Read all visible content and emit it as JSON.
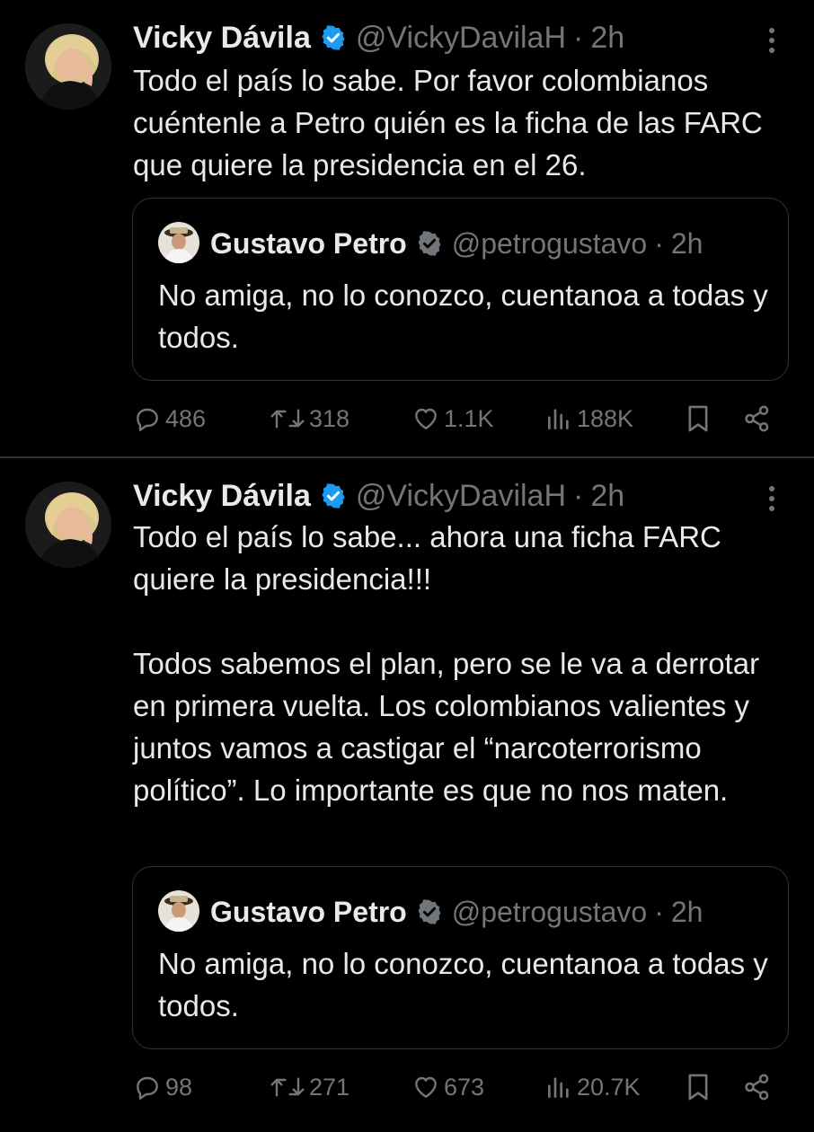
{
  "tweets": [
    {
      "author": {
        "name": "Vicky Dávila",
        "handle": "@VickyDavilaH",
        "time": "2h"
      },
      "text": "Todo el país lo sabe. Por favor colombianos cuéntenle a Petro quién es la ficha de las FARC que quiere la presidencia en el 26.",
      "quote": {
        "author": {
          "name": "Gustavo Petro",
          "handle": "@petrogustavo",
          "time": "2h"
        },
        "text": "No amiga, no lo conozco, cuentanoa a todas y todos."
      },
      "stats": {
        "replies": "486",
        "reposts": "318",
        "likes": "1.1K",
        "views": "188K"
      }
    },
    {
      "author": {
        "name": "Vicky Dávila",
        "handle": "@VickyDavilaH",
        "time": "2h"
      },
      "text": "Todo el país lo sabe... ahora una ficha FARC quiere la presidencia!!!\n\nTodos sabemos el plan, pero se le va a derrotar en primera vuelta. Los colombianos valientes y juntos vamos a castigar el “narcoterrorismo político”. Lo importante es que no nos maten.",
      "quote": {
        "author": {
          "name": "Gustavo Petro",
          "handle": "@petrogustavo",
          "time": "2h"
        },
        "text": "No amiga, no lo conozco, cuentanoa a todas y todos."
      },
      "stats": {
        "replies": "98",
        "reposts": "271",
        "likes": "673",
        "views": "20.7K"
      }
    }
  ],
  "separator": "·",
  "colors": {
    "background": "#000000",
    "text": "#e7e9ea",
    "muted": "#71767b",
    "verified": "#1d9bf0",
    "border": "#2f3336"
  },
  "icons": [
    "verified-badge-icon",
    "more-options-icon",
    "reply-icon",
    "repost-icon",
    "like-icon",
    "views-icon",
    "bookmark-icon",
    "share-icon"
  ]
}
